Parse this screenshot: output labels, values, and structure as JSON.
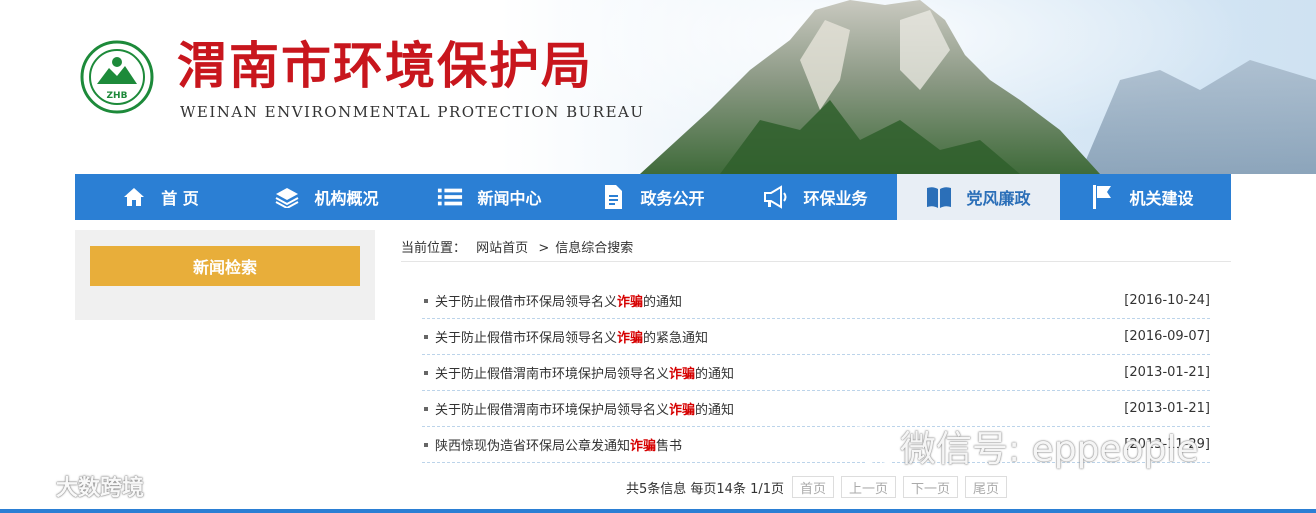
{
  "header": {
    "title": "渭南市环境保护局",
    "subtitle": "WEINAN ENVIRONMENTAL PROTECTION BUREAU",
    "logo_text": "ZHB"
  },
  "nav": {
    "items": [
      {
        "label": "首 页",
        "icon": "home-icon"
      },
      {
        "label": "机构概况",
        "icon": "layers-icon"
      },
      {
        "label": "新闻中心",
        "icon": "list-icon"
      },
      {
        "label": "政务公开",
        "icon": "document-icon"
      },
      {
        "label": "环保业务",
        "icon": "megaphone-icon"
      },
      {
        "label": "党风廉政",
        "icon": "book-icon",
        "active": true
      },
      {
        "label": "机关建设",
        "icon": "flag-icon"
      }
    ]
  },
  "sidebar": {
    "button_label": "新闻检索"
  },
  "breadcrumb": {
    "prefix": "当前位置：",
    "home": "网站首页",
    "separator": ">",
    "current": "信息综合搜索"
  },
  "news": [
    {
      "before": "关于防止假借市环保局领导名义",
      "highlight": "诈骗",
      "after": "的通知",
      "date": "[2016-10-24]"
    },
    {
      "before": "关于防止假借市环保局领导名义",
      "highlight": "诈骗",
      "after": "的紧急通知",
      "date": "[2016-09-07]"
    },
    {
      "before": "关于防止假借渭南市环境保护局领导名义",
      "highlight": "诈骗",
      "after": "的通知",
      "date": "[2013-01-21]"
    },
    {
      "before": "关于防止假借渭南市环境保护局领导名义",
      "highlight": "诈骗",
      "after": "的通知",
      "date": "[2013-01-21]"
    },
    {
      "before": "陕西惊现伪造省环保局公章发通知",
      "highlight": "诈骗",
      "after": "售书",
      "date": "[2013-11-29]"
    }
  ],
  "pagination": {
    "info": "共5条信息 每页14条 1/1页",
    "first": "首页",
    "prev": "上一页",
    "next": "下一页",
    "last": "尾页"
  },
  "watermarks": {
    "left": "大数跨境",
    "right": "微信号: eppeople"
  },
  "colors": {
    "nav_blue": "#2b7fd4",
    "title_red": "#c8161d",
    "highlight_red": "#d60000",
    "sidebar_gold": "#e8ae3a"
  }
}
